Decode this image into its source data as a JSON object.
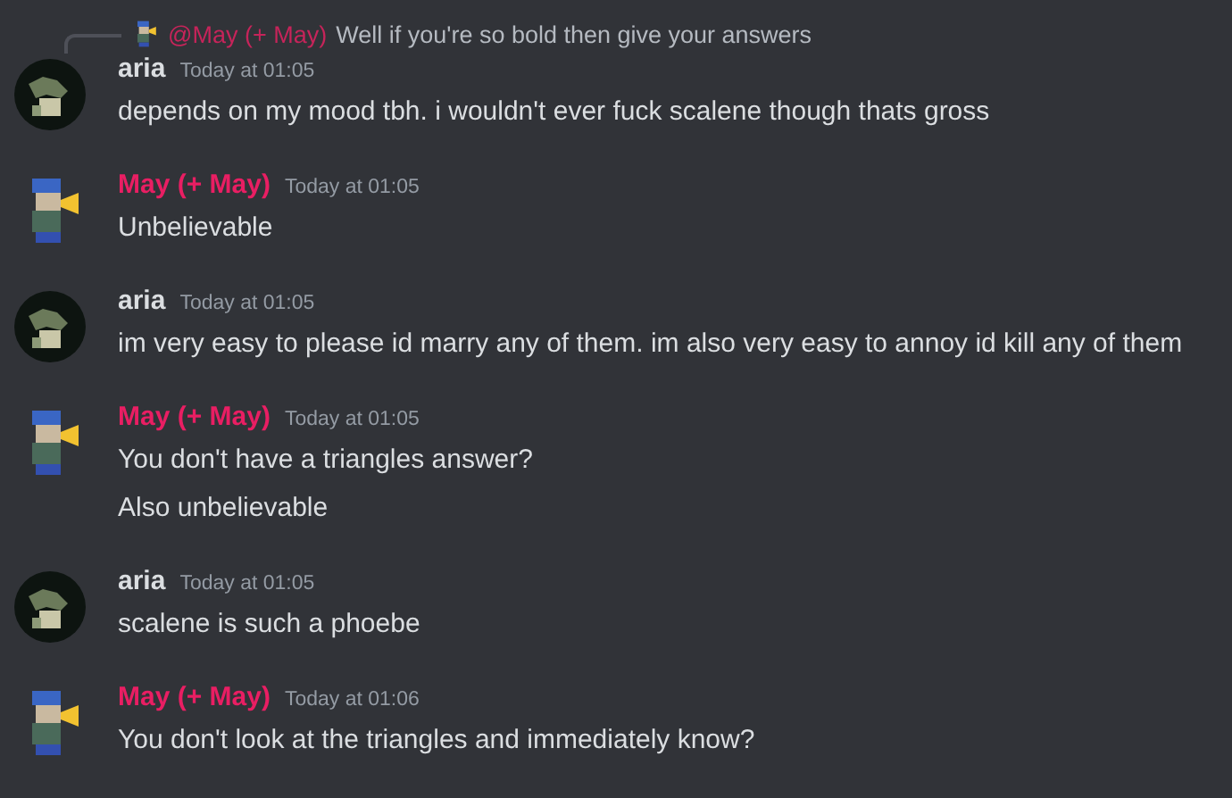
{
  "messages": [
    {
      "author": "aria",
      "kind": "dark",
      "color": "#dbdee1",
      "time": "Today at 01:05",
      "reply": {
        "author": "@May (+ May)",
        "color": "#c6245a",
        "text": "Well if you're so bold then give your answers"
      },
      "lines": [
        "depends on my mood tbh. i wouldn't ever fuck scalene though thats gross"
      ]
    },
    {
      "author": "May (+ May)",
      "kind": "figure",
      "color": "#e91e63",
      "time": "Today at 01:05",
      "lines": [
        "Unbelievable"
      ]
    },
    {
      "author": "aria",
      "kind": "dark",
      "color": "#dbdee1",
      "time": "Today at 01:05",
      "lines": [
        "im very easy to please id marry any of them. im also very easy to annoy id kill any of them"
      ]
    },
    {
      "author": "May (+ May)",
      "kind": "figure",
      "color": "#e91e63",
      "time": "Today at 01:05",
      "lines": [
        "You don't have a triangles answer?",
        "Also unbelievable"
      ]
    },
    {
      "author": "aria",
      "kind": "dark",
      "color": "#dbdee1",
      "time": "Today at 01:05",
      "lines": [
        "scalene is such a phoebe"
      ]
    },
    {
      "author": "May (+ May)",
      "kind": "figure",
      "color": "#e91e63",
      "time": "Today at 01:06",
      "lines": [
        "You don't look at the triangles and immediately know?"
      ]
    }
  ]
}
